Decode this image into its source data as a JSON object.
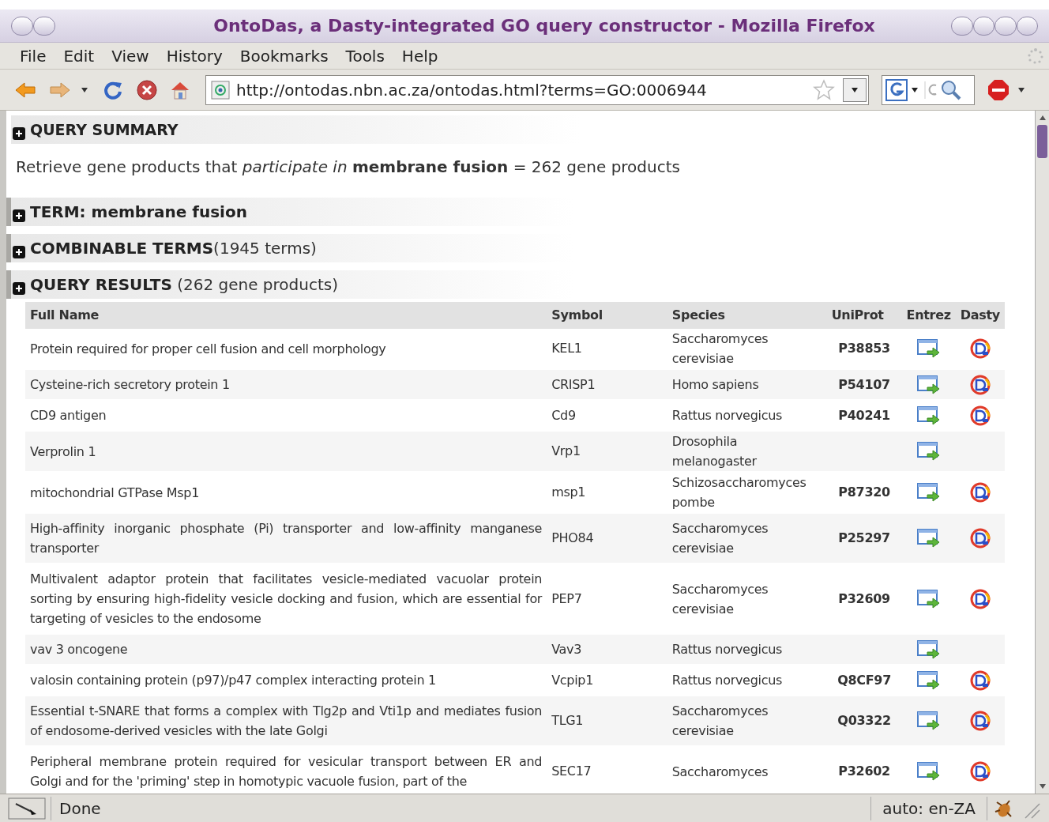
{
  "window": {
    "title": "OntoDas, a Dasty-integrated GO query constructor - Mozilla Firefox"
  },
  "menu": [
    {
      "label": "File"
    },
    {
      "label": "Edit"
    },
    {
      "label": "View"
    },
    {
      "label": "History"
    },
    {
      "label": "Bookmarks"
    },
    {
      "label": "Tools"
    },
    {
      "label": "Help"
    }
  ],
  "address_bar": {
    "value": "http://ontodas.nbn.ac.za/ontodas.html?terms=GO:0006944"
  },
  "query_summary": {
    "title": "QUERY SUMMARY",
    "text": "Retrieve gene products that *participate in* **membrane fusion** = 262 gene products"
  },
  "sections": [
    {
      "title": "TERM: membrane fusion"
    },
    {
      "title": "COMBINABLE TERMS",
      "note": "(1945 terms)"
    },
    {
      "title": "QUERY RESULTS",
      "note": " (262 gene products)"
    }
  ],
  "table": {
    "columns": [
      "Full Name",
      "Symbol",
      "Species",
      "UniProt",
      "Entrez",
      "Dasty"
    ],
    "rows": [
      {
        "full_name": "Protein required for proper cell fusion and cell morphology",
        "symbol": "KEL1",
        "species": "Saccharomyces cerevisiae",
        "uniprot": "P38853",
        "dasty": true
      },
      {
        "full_name": "Cysteine-rich secretory protein 1",
        "symbol": "CRISP1",
        "species": "Homo sapiens",
        "uniprot": "P54107",
        "dasty": true
      },
      {
        "full_name": "CD9 antigen",
        "symbol": "Cd9",
        "species": "Rattus norvegicus",
        "uniprot": "P40241",
        "dasty": true
      },
      {
        "full_name": "Verprolin 1",
        "symbol": "Vrp1",
        "species": "Drosophila melanogaster",
        "dasty": false
      },
      {
        "full_name": "mitochondrial GTPase Msp1",
        "symbol": "msp1",
        "species": "Schizosaccharomyces pombe",
        "uniprot": "P87320",
        "dasty": true
      },
      {
        "full_name": "High-affinity inorganic phosphate (Pi) transporter and low-affinity manganese transporter",
        "symbol": "PHO84",
        "species": "Saccharomyces cerevisiae",
        "uniprot": "P25297",
        "dasty": true
      },
      {
        "full_name": "Multivalent adaptor protein that facilitates vesicle-mediated vacuolar protein sorting by ensuring high-fidelity vesicle docking and fusion, which are essential for targeting of vesicles to the endosome",
        "symbol": "PEP7",
        "species": "Saccharomyces cerevisiae",
        "uniprot": "P32609",
        "dasty": true
      },
      {
        "full_name": "vav 3 oncogene",
        "symbol": "Vav3",
        "species": "Rattus norvegicus",
        "dasty": false
      },
      {
        "full_name": "valosin containing protein (p97)/p47 complex interacting protein 1",
        "symbol": "Vcpip1",
        "species": "Rattus norvegicus",
        "uniprot": "Q8CF97",
        "dasty": true
      },
      {
        "full_name": "Essential t-SNARE that forms a complex with Tlg2p and Vti1p and mediates fusion of endosome-derived vesicles with the late Golgi",
        "symbol": "TLG1",
        "species": "Saccharomyces cerevisiae",
        "uniprot": "Q03322",
        "dasty": true
      },
      {
        "full_name": "Peripheral membrane protein required for vesicular transport between ER and Golgi and for the 'priming' step in homotypic vacuole fusion, part of the",
        "symbol": "SEC17",
        "species": "Saccharomyces",
        "uniprot": "P32602",
        "dasty": true
      }
    ]
  },
  "status_bar": {
    "text": "Done",
    "language": "auto: en-ZA"
  }
}
